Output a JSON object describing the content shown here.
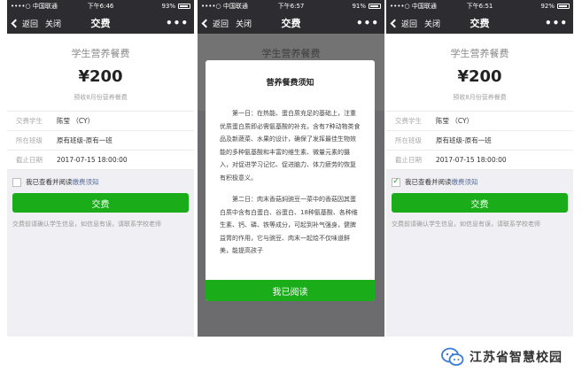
{
  "statusbar": {
    "carrier": "••••○ 中国联通",
    "times": [
      "下午6:46",
      "下午6:57",
      "下午6:51"
    ],
    "battery": [
      "93%",
      "91%",
      "92%"
    ]
  },
  "navbar": {
    "back_label": "返回",
    "close_label": "关闭",
    "title": "交费",
    "more": "•••"
  },
  "payment": {
    "fee_title": "学生营养餐费",
    "amount": "¥200",
    "note": "预收8月份营养餐费",
    "rows": [
      {
        "label": "交费学生",
        "value": "陈莹 （CY）"
      },
      {
        "label": "所在班级",
        "value": "原有班级-原有一班"
      },
      {
        "label": "截止日期",
        "value": "2017-07-15 18:00:00"
      }
    ],
    "agree_text": "我已查看并阅读",
    "agree_link": "缴费须知",
    "pay_button": "交费",
    "tip": "交费前请确认学生信息，如信息有误，请联系学校老师"
  },
  "modal": {
    "title": "营养餐费须知",
    "paragraph1": "第一日：在热能、蛋白质充足的基础上，注重优质蛋白质即必需氨基酸的补充，含有7种动物类食品及新蔬菜、水果的设计，确保了发挥最佳生物效能的多种氨基酸和丰富的维生素、微量元素的摄入，对促进学习记忆、促进脑力、体力疲劳的恢复有积极意义。",
    "paragraph2": "第二日：肉末香菇焖豌豆一菜中的香菇因其蛋白质中含有白蛋白、谷蛋白、18种氨基酸、各种维生素、钙、磷、铁等成分，可起到补气强身，健脾益胃的作用，它与豌豆、肉末一起烩不仅味道鲜美，能提高孩子",
    "read_button": "我已阅读"
  },
  "checkbox_states": [
    "unchecked",
    "unchecked",
    "checked"
  ],
  "watermark": {
    "text": "江苏省智慧校园"
  },
  "colors": {
    "accent_green": "#1aad19",
    "navbar": "#2d2d31",
    "link": "#576b95",
    "watermark_blue": "#3a7bd5"
  }
}
